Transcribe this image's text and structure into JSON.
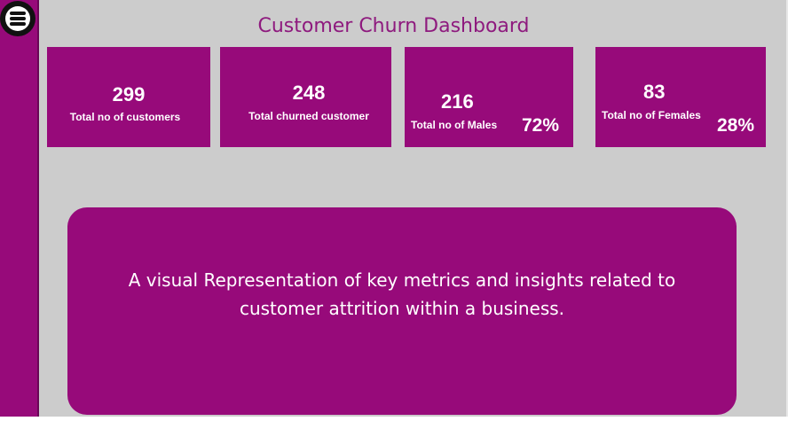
{
  "header": {
    "title": "Customer Churn Dashboard"
  },
  "cards": [
    {
      "value": "299",
      "label": "Total no of customers"
    },
    {
      "value": "248",
      "label": "Total churned customer"
    },
    {
      "value": "216",
      "label": "Total no of Males",
      "percent": "72%"
    },
    {
      "value": "83",
      "label": "Total no of Females",
      "percent": "28%"
    }
  ],
  "description": {
    "text": "A visual Representation of key metrics and insights related to customer attrition within a business."
  },
  "colors": {
    "accent": "#970a7a",
    "title_text": "#8e1a7e",
    "canvas": "#cccccc",
    "card_text": "#ffffff"
  },
  "icons": {
    "menu": "hamburger-menu-icon"
  }
}
